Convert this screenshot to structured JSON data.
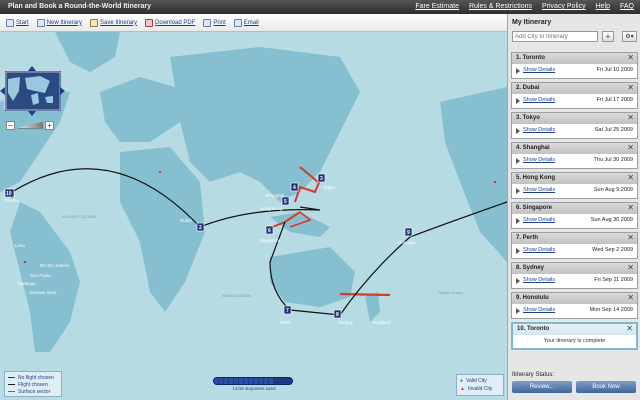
{
  "header": {
    "title": "Plan and Book a Round-the-World Itinerary",
    "links": [
      "Fare Estimate",
      "Rules & Restrictions",
      "Privacy Policy",
      "Help",
      "FAQ"
    ]
  },
  "toolbar": {
    "items": [
      {
        "label": "Start",
        "icon": "start-icon"
      },
      {
        "label": "New Itinerary",
        "icon": "new-itinerary-icon"
      },
      {
        "label": "Save Itinerary",
        "icon": "save-icon"
      },
      {
        "label": "Download PDF",
        "icon": "pdf-icon"
      },
      {
        "label": "Print",
        "icon": "print-icon"
      },
      {
        "label": "Email",
        "icon": "email-icon"
      }
    ]
  },
  "map": {
    "labels": {
      "atlantic": "ATLANTIC OCEAN",
      "indian": "INDIAN OCEAN",
      "pacific": "Pacific Ocean",
      "toronto": "Toronto",
      "dubai": "Dubai",
      "tokyo": "Tokyo",
      "shanghai": "Shanghai",
      "hongkong": "Hong Kong",
      "singapore": "Singapore",
      "perth": "Perth",
      "sydney": "Sydney",
      "auckland": "Auckland",
      "honolulu": "Honolulu",
      "riodejaneiro": "Rio De Janeiro",
      "saopaulo": "Sao Paulo",
      "buenosaires": "Buenos Aires",
      "santiago": "Santiago",
      "lima": "Lima"
    },
    "markers": [
      "1",
      "2",
      "3",
      "4",
      "5",
      "6",
      "7",
      "8",
      "9",
      "10"
    ]
  },
  "legend": {
    "no_flight": "No flight chosen",
    "flight": "Flight chosen",
    "surface": "Surface sector",
    "colors": {
      "no_flight": "#1c3f8c",
      "flight": "#1a1a1a",
      "surface": "#d63a2a"
    }
  },
  "counter": {
    "text": "12/16 stopovers used",
    "fraction": 0.75
  },
  "validity": {
    "valid": "Valid City",
    "invalid": "Invalid City"
  },
  "panel": {
    "title": "My Itinerary",
    "add_placeholder": "Add City to Itinerary",
    "add_button": "+",
    "gear_button": "⚙▾",
    "legs": [
      {
        "label": "1. Toronto",
        "details": "Show Details",
        "date": "Fri Jul 10 2009"
      },
      {
        "label": "2. Dubai",
        "details": "Show Details",
        "date": "Fri Jul 17 2009"
      },
      {
        "label": "3. Tokyo",
        "details": "Show Details",
        "date": "Sat Jul 25 2009"
      },
      {
        "label": "4. Shanghai",
        "details": "Show Details",
        "date": "Thu Jul 30 2009"
      },
      {
        "label": "5. Hong Kong",
        "details": "Show Details",
        "date": "Sun Aug 9 2009"
      },
      {
        "label": "6. Singapore",
        "details": "Show Details",
        "date": "Sun Aug 30 2009"
      },
      {
        "label": "7. Perth",
        "details": "Show Details",
        "date": "Wed Sep 2 2009"
      },
      {
        "label": "8. Sydney",
        "details": "Show Details",
        "date": "Fri Sep 11 2009"
      },
      {
        "label": "9. Honolulu",
        "details": "Show Details",
        "date": "Mon Sep 14 2009"
      }
    ],
    "final": {
      "label": "10. Toronto",
      "message": "Your itinerary is complete"
    },
    "status_label": "Itinerary Status:",
    "review": "Review...",
    "book_now": "Book Now"
  }
}
